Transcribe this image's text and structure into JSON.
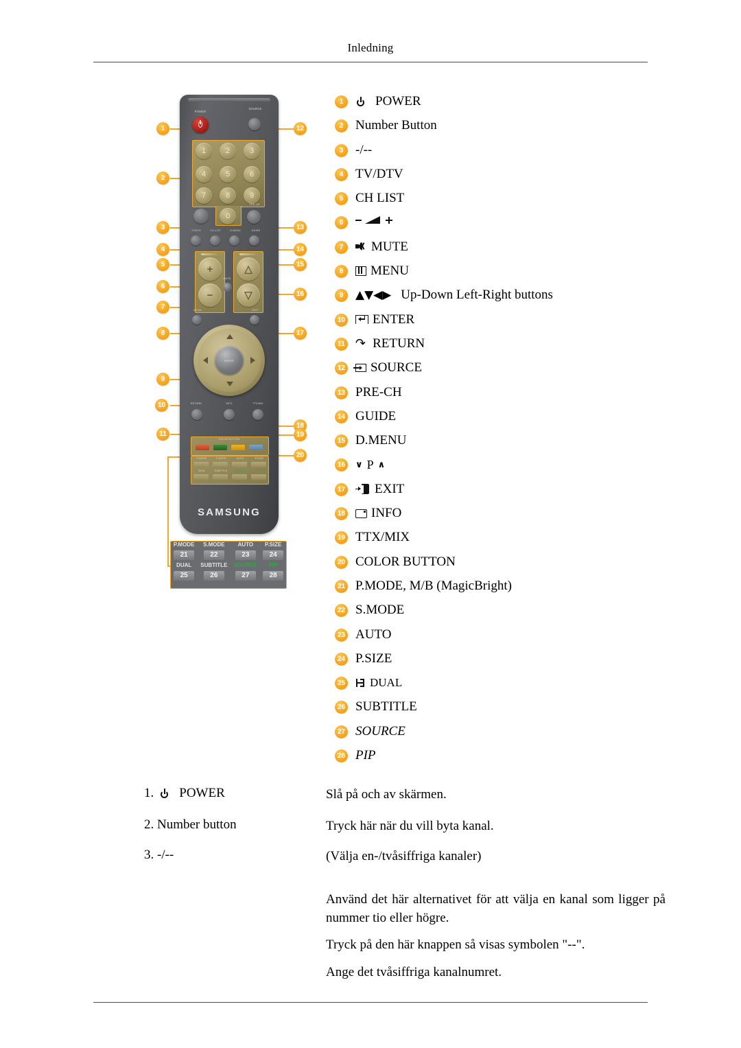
{
  "header": {
    "title": "Inledning"
  },
  "remote": {
    "brand": "SAMSUNG",
    "labels": {
      "power": "POWER",
      "source": "SOURCE",
      "pre_ch": "PRE-CH",
      "tv_dtv": "TV/DTV",
      "ch_list": "CH LIST",
      "d_menu": "D.MENU",
      "guide": "GUIDE",
      "mute": "MUTE",
      "menu": "MENU",
      "exit": "EXIT",
      "return": "RETURN",
      "info": "INFO",
      "ttx_mix": "TTX/MIX",
      "color_button": "COLOR BUTTON",
      "enter": "ENTER"
    },
    "keypad": [
      "1",
      "2",
      "3",
      "4",
      "5",
      "6",
      "7",
      "8",
      "9",
      "0"
    ],
    "vol_plus": "+",
    "vol_minus": "−",
    "detail_box": {
      "row1_labels": [
        "P.MODE",
        "S.MODE",
        "AUTO",
        "P.SIZE"
      ],
      "row1_keys": [
        "21",
        "22",
        "23",
        "24"
      ],
      "row2_labels": [
        "DUAL",
        "SUBTITLE",
        "SOURCE",
        "PIP"
      ],
      "row2_keys": [
        "25",
        "26",
        "27",
        "28"
      ],
      "green_labels": [
        "SOURCE",
        "PIP"
      ]
    },
    "callout_numbers_left": [
      "1",
      "2",
      "3",
      "4",
      "5",
      "6",
      "7",
      "8",
      "9",
      "10",
      "11"
    ],
    "callout_numbers_right": [
      "12",
      "13",
      "14",
      "15",
      "16",
      "17",
      "18",
      "19",
      "20"
    ]
  },
  "legend": [
    {
      "n": "1",
      "icon": "power-icon",
      "text": "POWER"
    },
    {
      "n": "2",
      "icon": "",
      "text": "Number Button"
    },
    {
      "n": "3",
      "icon": "",
      "text": "-/--"
    },
    {
      "n": "4",
      "icon": "",
      "text": "TV/DTV"
    },
    {
      "n": "5",
      "icon": "",
      "text": "CH LIST"
    },
    {
      "n": "6",
      "icon": "volume-icon",
      "text": ""
    },
    {
      "n": "7",
      "icon": "mute-icon",
      "text": "MUTE"
    },
    {
      "n": "8",
      "icon": "menu-icon",
      "text": "MENU"
    },
    {
      "n": "9",
      "icon": "arrows-icon",
      "text": "Up-Down Left-Right buttons"
    },
    {
      "n": "10",
      "icon": "enter-icon",
      "text": "ENTER"
    },
    {
      "n": "11",
      "icon": "return-icon",
      "text": "RETURN"
    },
    {
      "n": "12",
      "icon": "source-icon",
      "text": "SOURCE"
    },
    {
      "n": "13",
      "icon": "",
      "text": "PRE-CH"
    },
    {
      "n": "14",
      "icon": "",
      "text": "GUIDE"
    },
    {
      "n": "15",
      "icon": "",
      "text": "D.MENU"
    },
    {
      "n": "16",
      "icon": "updown-p-icon",
      "text": ""
    },
    {
      "n": "17",
      "icon": "exit-icon",
      "text": "EXIT"
    },
    {
      "n": "18",
      "icon": "info-icon",
      "text": "INFO"
    },
    {
      "n": "19",
      "icon": "",
      "text": "TTX/MIX"
    },
    {
      "n": "20",
      "icon": "",
      "text": "COLOR BUTTON"
    },
    {
      "n": "21",
      "icon": "",
      "text": "P.MODE, M/B (MagicBright)"
    },
    {
      "n": "22",
      "icon": "",
      "text": "S.MODE"
    },
    {
      "n": "23",
      "icon": "",
      "text": "AUTO"
    },
    {
      "n": "24",
      "icon": "",
      "text": "P.SIZE"
    },
    {
      "n": "25",
      "icon": "dual-icon",
      "text": "DUAL"
    },
    {
      "n": "26",
      "icon": "",
      "text": "SUBTITLE"
    },
    {
      "n": "27",
      "icon": "",
      "text": "SOURCE",
      "italic": true
    },
    {
      "n": "28",
      "icon": "",
      "text": "PIP",
      "italic": true
    }
  ],
  "legend_arrows_16": {
    "down": "∨",
    "p": "P",
    "up": "∧"
  },
  "description": {
    "item1_num": "1.",
    "item1_label": "POWER",
    "item1_text": "Slå på och av skärmen.",
    "item2_label": "2. Number button",
    "item2_text": "Tryck här när du vill byta kanal.",
    "item3_label": "3. -/--",
    "item3_text": "(Välja en-/tvåsiffriga kanaler)",
    "item3_para1": "Använd det här alternativet för att välja en kanal som ligger på nummer tio eller högre.",
    "item3_para2": "Tryck på den här knappen så visas symbolen \"--\".",
    "item3_para3": "Ange det tvåsiffriga kanalnumret."
  },
  "colors": {
    "badge": "#F5A623",
    "accent_line": "#F2A72C",
    "remote_body": "#575960",
    "keypad": "#8d8253",
    "color_button_red": "#C8482A",
    "color_button_green": "#2F7A2C",
    "color_button_yellow": "#E5A50E",
    "color_button_blue": "#6A93B6",
    "green_text": "#2FA84A"
  }
}
